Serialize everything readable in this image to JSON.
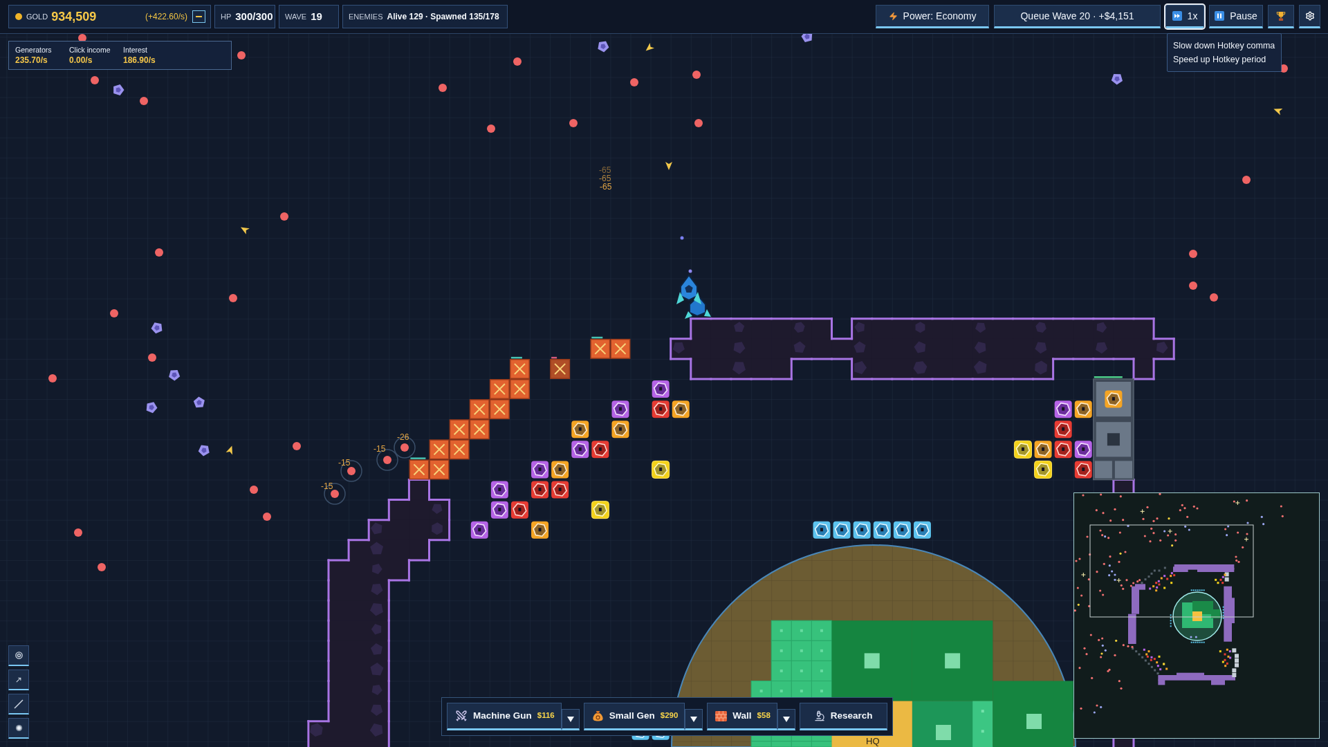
{
  "top_bar": {
    "gold": {
      "label": "GOLD",
      "value": "934,509",
      "rate": "(+422.60/s)"
    },
    "stats": [
      {
        "label": "HP",
        "value": "300/300"
      },
      {
        "label": "WAVE",
        "value": "19"
      },
      {
        "label": "ENEMIES",
        "value": "Alive 129 · Spawned 135/178"
      }
    ],
    "actions": [
      {
        "kind": "power",
        "label": "Power: Economy"
      },
      {
        "kind": "queue",
        "label": "Queue Wave 20 · +$4,151"
      },
      {
        "kind": "speed",
        "label": "1x",
        "hovered": true
      },
      {
        "kind": "pause",
        "label": "Pause"
      }
    ]
  },
  "income": [
    {
      "label": "Generators",
      "value": "235.70/s"
    },
    {
      "label": "Click income",
      "value": "0.00/s"
    },
    {
      "label": "Interest",
      "value": "186.90/s"
    }
  ],
  "speed_tooltip": [
    "Slow down Hotkey comma",
    "Speed up Hotkey period"
  ],
  "damage_numbers": [
    "-65",
    "-65",
    "-65",
    "-26",
    "-15",
    "-15",
    "-15"
  ],
  "hq_label": "HQ",
  "build_bar": [
    {
      "kind": "machine_gun",
      "label": "Machine Gun",
      "price": "$116"
    },
    {
      "kind": "small_gen",
      "label": "Small Gen",
      "price": "$290"
    },
    {
      "kind": "wall",
      "label": "Wall",
      "price": "$58"
    },
    {
      "kind": "research",
      "label": "Research"
    }
  ]
}
